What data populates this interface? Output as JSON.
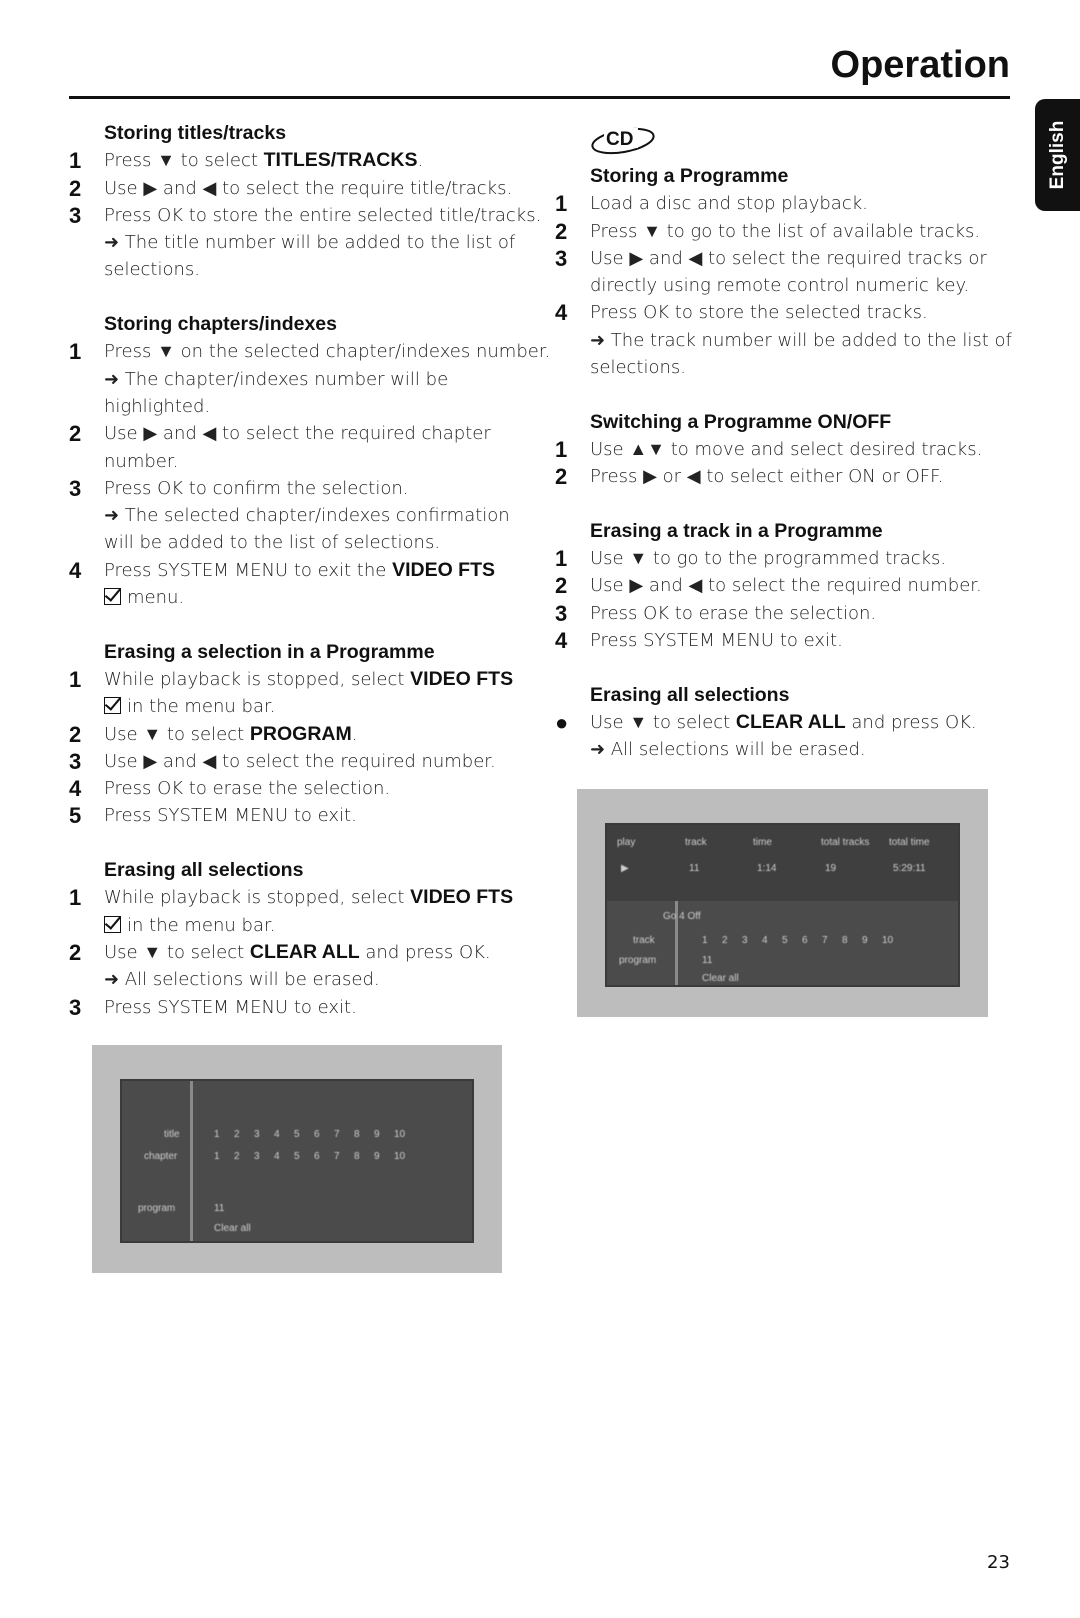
{
  "header": {
    "title": "Operation",
    "language_tab": "English"
  },
  "cd_logo": "CD",
  "page_number": "23",
  "left_column": [
    {
      "heading": "Storing titles/tracks",
      "lines": [
        {
          "num": "1",
          "seg": [
            {
              "t": "Press ▼ to select "
            },
            {
              "t": "TITLES/TRACKS",
              "b": true
            },
            {
              "t": "."
            }
          ]
        },
        {
          "num": "2",
          "seg": [
            {
              "t": "Use ▶ and ◀ to select the require title/tracks."
            }
          ]
        },
        {
          "num": "3",
          "seg": [
            {
              "t": "Press OK to store the entire selected title/tracks."
            }
          ]
        },
        {
          "seg": [
            {
              "t": "➜ The title number will be added to the list of"
            }
          ]
        },
        {
          "seg": [
            {
              "t": "selections."
            }
          ]
        }
      ]
    },
    {
      "heading": "Storing chapters/indexes",
      "lines": [
        {
          "num": "1",
          "seg": [
            {
              "t": "Press ▼ on the selected chapter/indexes number."
            }
          ]
        },
        {
          "seg": [
            {
              "t": "➜ The chapter/indexes number will be"
            }
          ]
        },
        {
          "seg": [
            {
              "t": "highlighted."
            }
          ]
        },
        {
          "num": "2",
          "seg": [
            {
              "t": "Use ▶ and ◀ to select the required chapter"
            }
          ]
        },
        {
          "seg": [
            {
              "t": "number."
            }
          ]
        },
        {
          "num": "3",
          "seg": [
            {
              "t": "Press OK to confirm the selection."
            }
          ]
        },
        {
          "seg": [
            {
              "t": "➜ The selected chapter/indexes confirmation"
            }
          ]
        },
        {
          "seg": [
            {
              "t": "will be added to the list of selections."
            }
          ]
        },
        {
          "num": "4",
          "seg": [
            {
              "t": "Press SYSTEM MENU to exit the "
            },
            {
              "t": "VIDEO FTS",
              "b": true
            }
          ]
        },
        {
          "seg": [
            {
              "icon": "checkbox"
            },
            {
              "t": "menu."
            }
          ]
        }
      ]
    },
    {
      "heading": "Erasing a selection in a Programme",
      "lines": [
        {
          "num": "1",
          "seg": [
            {
              "t": "While playback is stopped, select "
            },
            {
              "t": "VIDEO FTS",
              "b": true
            }
          ]
        },
        {
          "seg": [
            {
              "icon": "checkbox"
            },
            {
              "t": "in the menu bar."
            }
          ]
        },
        {
          "num": "2",
          "seg": [
            {
              "t": "Use ▼ to select "
            },
            {
              "t": "PROGRAM",
              "b": true
            },
            {
              "t": "."
            }
          ]
        },
        {
          "num": "3",
          "seg": [
            {
              "t": "Use ▶ and ◀ to select the required number."
            }
          ]
        },
        {
          "num": "4",
          "seg": [
            {
              "t": "Press OK to erase the selection."
            }
          ]
        },
        {
          "num": "5",
          "seg": [
            {
              "t": "Press SYSTEM MENU to exit."
            }
          ]
        }
      ]
    },
    {
      "heading": "Erasing all selections",
      "lines": [
        {
          "num": "1",
          "seg": [
            {
              "t": "While playback is stopped, select "
            },
            {
              "t": "VIDEO FTS",
              "b": true
            }
          ]
        },
        {
          "seg": [
            {
              "icon": "checkbox"
            },
            {
              "t": "in the menu bar."
            }
          ]
        },
        {
          "num": "2",
          "seg": [
            {
              "t": "Use ▼ to select "
            },
            {
              "t": "CLEAR ALL",
              "b": true
            },
            {
              "t": " and press OK."
            }
          ]
        },
        {
          "seg": [
            {
              "t": "➜ All selections will be erased."
            }
          ]
        },
        {
          "num": "3",
          "seg": [
            {
              "t": "Press SYSTEM MENU to exit."
            }
          ]
        }
      ]
    }
  ],
  "right_column": [
    {
      "heading": "Storing a Programme",
      "lines": [
        {
          "num": "1",
          "seg": [
            {
              "t": "Load a disc and stop playback."
            }
          ]
        },
        {
          "num": "2",
          "seg": [
            {
              "t": "Press ▼ to go to the list of available tracks."
            }
          ]
        },
        {
          "num": "3",
          "seg": [
            {
              "t": "Use ▶ and ◀ to select the required tracks or"
            }
          ]
        },
        {
          "seg": [
            {
              "t": "directly using remote control numeric key."
            }
          ]
        },
        {
          "num": "4",
          "seg": [
            {
              "t": "Press OK to store the selected tracks."
            }
          ]
        },
        {
          "seg": [
            {
              "t": "➜ The track number will be added to the list of"
            }
          ]
        },
        {
          "seg": [
            {
              "t": "selections."
            }
          ]
        }
      ]
    },
    {
      "heading": "Switching a Programme ON/OFF",
      "lines": [
        {
          "num": "1",
          "seg": [
            {
              "t": "Use ▲▼ to move and select desired tracks."
            }
          ]
        },
        {
          "num": "2",
          "seg": [
            {
              "t": "Press ▶ or ◀ to select either ON or OFF."
            }
          ]
        }
      ]
    },
    {
      "heading": "Erasing a track in a Programme",
      "lines": [
        {
          "num": "1",
          "seg": [
            {
              "t": "Use ▼ to go to the programmed tracks."
            }
          ]
        },
        {
          "num": "2",
          "seg": [
            {
              "t": "Use ▶ and ◀ to select the required number."
            }
          ]
        },
        {
          "num": "3",
          "seg": [
            {
              "t": "Press OK to erase the selection."
            }
          ]
        },
        {
          "num": "4",
          "seg": [
            {
              "t": "Press SYSTEM MENU to exit."
            }
          ]
        }
      ]
    },
    {
      "heading": "Erasing all selections",
      "lines": [
        {
          "num": "●",
          "seg": [
            {
              "t": "Use ▼ to select "
            },
            {
              "t": "CLEAR ALL",
              "b": true
            },
            {
              "t": " and press OK."
            }
          ]
        },
        {
          "seg": [
            {
              "t": "➜ All selections will be erased."
            }
          ]
        }
      ]
    }
  ],
  "screen_cd": {
    "columns": [
      "play",
      "track",
      "time",
      "total tracks",
      "total time"
    ],
    "values": [
      "▶",
      "11",
      "1:14",
      "19",
      "5:29:11"
    ],
    "row_labels": [
      "track",
      "program"
    ],
    "program_state": "Go 4 Off",
    "tracks": [
      "1",
      "2",
      "3",
      "4",
      "5",
      "6",
      "7",
      "8",
      "9",
      "10"
    ],
    "program": "11",
    "clear": "Clear all"
  },
  "screen_dvd": {
    "row_labels": [
      "title",
      "chapter",
      "program"
    ],
    "titles": [
      "1",
      "2",
      "3",
      "4",
      "5",
      "6",
      "7",
      "8",
      "9",
      "10"
    ],
    "chapters": [
      "1",
      "2",
      "3",
      "4",
      "5",
      "6",
      "7",
      "8",
      "9",
      "10"
    ],
    "program": "11",
    "clear": "Clear all"
  }
}
